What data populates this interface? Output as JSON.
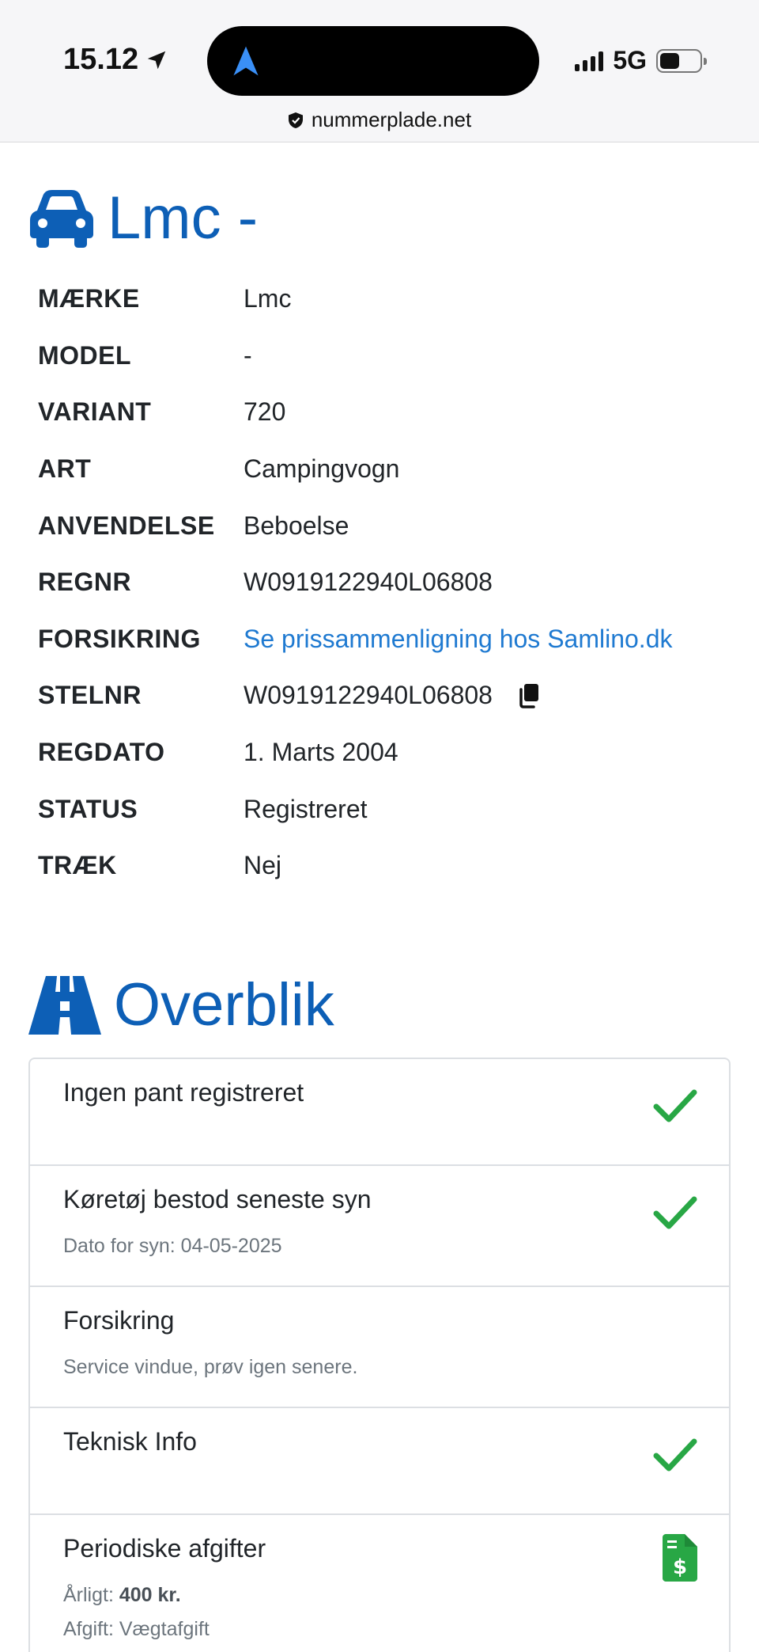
{
  "status_bar": {
    "time": "15.12",
    "network": "5G",
    "url": "nummerplade.net"
  },
  "vehicle": {
    "heading": "Lmc -",
    "rows": [
      {
        "label": "MÆRKE",
        "value": "Lmc"
      },
      {
        "label": "MODEL",
        "value": "-"
      },
      {
        "label": "VARIANT",
        "value": "720"
      },
      {
        "label": "ART",
        "value": "Campingvogn"
      },
      {
        "label": "ANVENDELSE",
        "value": "Beboelse"
      },
      {
        "label": "REGNR",
        "value": "W0919122940L06808"
      },
      {
        "label": "FORSIKRING",
        "value": "Se prissammenligning hos Samlino.dk"
      },
      {
        "label": "STELNR",
        "value": "W0919122940L06808"
      },
      {
        "label": "REGDATO",
        "value": "1. Marts 2004"
      },
      {
        "label": "STATUS",
        "value": "Registreret"
      },
      {
        "label": "TRÆK",
        "value": "Nej"
      }
    ]
  },
  "overview": {
    "heading": "Overblik",
    "items": [
      {
        "title": "Ingen pant registreret",
        "icon": "check-icon"
      },
      {
        "title": "Køretøj bestod seneste syn",
        "subtitle": "Dato for syn: 04-05-2025",
        "icon": "check-icon"
      },
      {
        "title": "Forsikring",
        "subtitle": "Service vindue, prøv igen senere."
      },
      {
        "title": "Teknisk Info",
        "icon": "check-icon"
      },
      {
        "title": "Periodiske afgifter",
        "annual_label": "Årligt:",
        "annual_value": "400 kr.",
        "fee_label": "Afgift: Vægtafgift",
        "icon": "invoice-dollar-icon"
      }
    ]
  },
  "colors": {
    "heading_blue": "#0d5fb6",
    "link_blue": "#1f7ad1",
    "success_green": "#28a745"
  }
}
